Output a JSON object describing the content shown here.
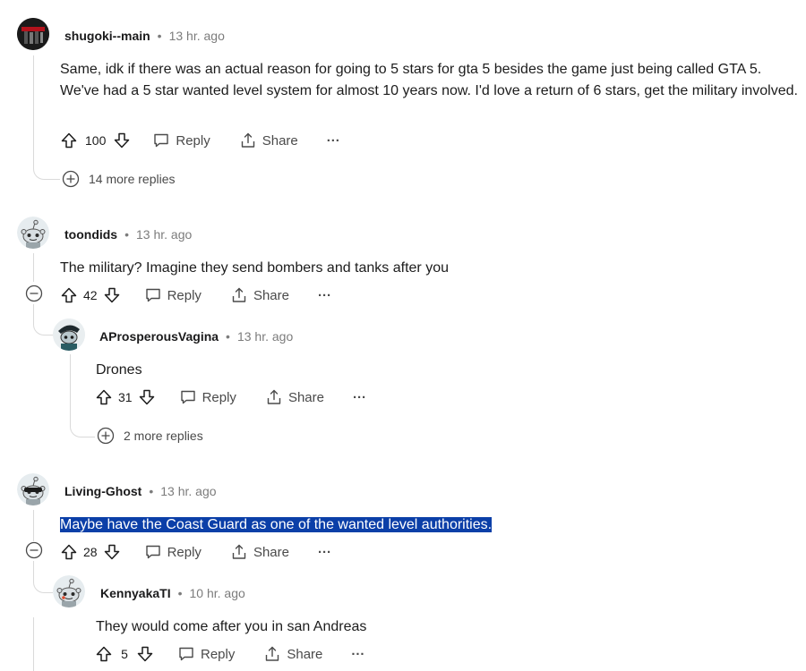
{
  "comments": [
    {
      "username": "shugoki--main",
      "time": "13 hr. ago",
      "text": "Same, idk if there was an actual reason for going to 5 stars for gta 5 besides the game just being called GTA 5. We've had a 5 star wanted level system for almost 10 years now. I'd love a return of 6 stars, get the military involved.",
      "votes": "100",
      "more_replies": "14 more replies"
    },
    {
      "username": "toondids",
      "time": "13 hr. ago",
      "text": "The military? Imagine they send bombers and tanks after you",
      "votes": "42"
    },
    {
      "username": "AProsperousVagina",
      "time": "13 hr. ago",
      "text": "Drones",
      "votes": "31",
      "more_replies": "2 more replies"
    },
    {
      "username": "Living-Ghost",
      "time": "13 hr. ago",
      "text": "Maybe have the Coast Guard as one of the wanted level authorities.",
      "votes": "28"
    },
    {
      "username": "KennyakaTI",
      "time": "10 hr. ago",
      "text": "They would come after you in san Andreas",
      "votes": "5"
    }
  ],
  "labels": {
    "separator": "•",
    "reply": "Reply",
    "share": "Share",
    "more": "···"
  },
  "colors": {
    "selection": "#0b3fa8",
    "thread_line": "#dadada"
  }
}
